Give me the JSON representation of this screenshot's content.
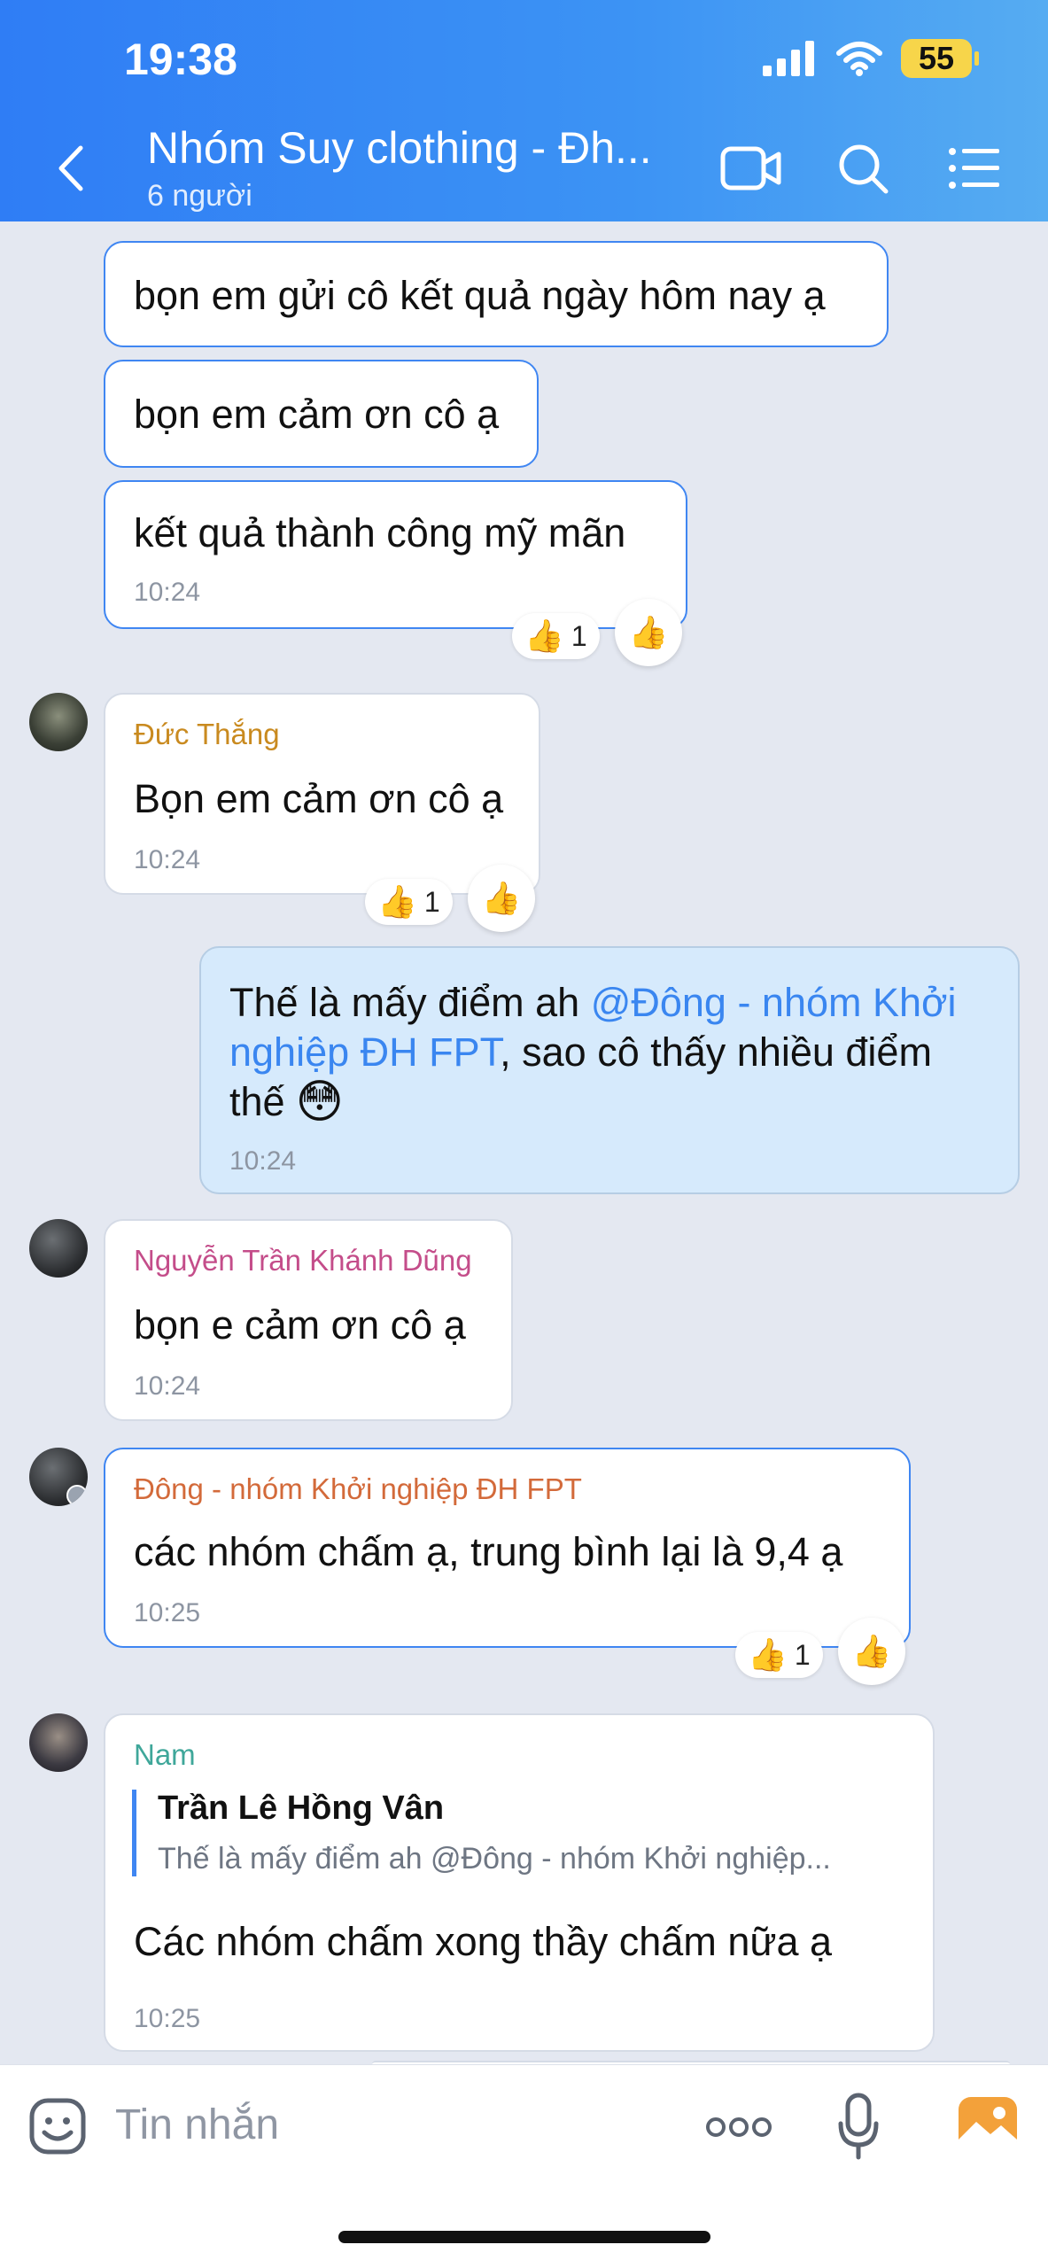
{
  "status_bar": {
    "time": "19:38",
    "battery": "55"
  },
  "header": {
    "title": "Nhóm Suy clothing - Đh...",
    "subtitle": "6 người"
  },
  "messages": [
    {
      "text": "bọn em gửi cô kết quả ngày hôm nay ạ"
    },
    {
      "text": "bọn em cảm ơn cô ạ"
    },
    {
      "text": "kết quả thành công mỹ mãn",
      "time": "10:24",
      "reaction_count": "1"
    },
    {
      "sender": "Đức Thắng",
      "text": "Bọn em cảm ơn cô ạ",
      "time": "10:24",
      "reaction_count": "1"
    },
    {
      "text_before": "Thế là mấy điểm ah ",
      "mention": "@Đông - nhóm Khởi",
      "mention2": "nghiệp ĐH FPT",
      "text_after": ", sao cô thấy nhiều điểm",
      "text_line3": "thế",
      "time": "10:24"
    },
    {
      "sender": "Nguyễn Trần Khánh Dũng",
      "text": "bọn e cảm ơn cô ạ",
      "time": "10:24"
    },
    {
      "sender": "Đông - nhóm Khởi nghiệp ĐH FPT",
      "text": "các nhóm chấm ạ, trung bình lại là 9,4 ạ",
      "time": "10:25",
      "reaction_count": "1"
    },
    {
      "sender": "Nam",
      "quote_author": "Trần Lê Hồng Vân",
      "quote_text": "Thế là mấy điểm ah @Đông - nhóm Khởi nghiệp...",
      "text": "Các nhóm chấm xong thầy chấm nữa ạ",
      "time": "10:25"
    }
  ],
  "input": {
    "placeholder": "Tin nhắn"
  },
  "colors": {
    "header": "#2f7df5",
    "bubble_border_active": "#3f86f2",
    "sender_duc_thang": "#c98a1f",
    "sender_khanh_dung": "#c44d8a",
    "sender_dong": "#d36a3a",
    "sender_nam": "#3fa79a"
  }
}
